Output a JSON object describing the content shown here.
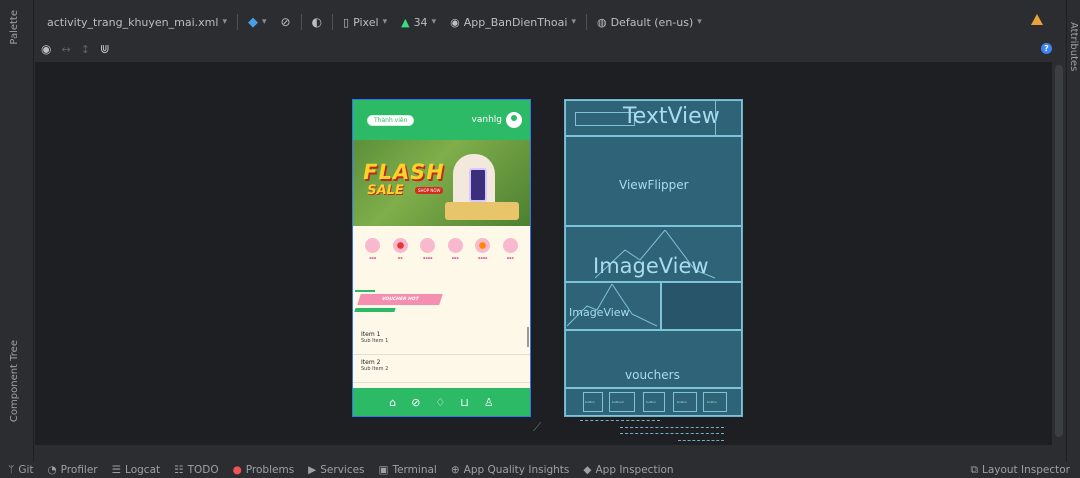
{
  "toolbar": {
    "file_name": "activity_trang_khuyen_mai.xml",
    "device": "Pixel",
    "api": "34",
    "theme": "App_BanDienThoai",
    "locale": "Default (en-us)"
  },
  "side_tabs": {
    "palette": "Palette",
    "component_tree": "Component Tree",
    "attributes": "Attributes"
  },
  "phone": {
    "member_label": "Thành viên",
    "username": "vanhlg",
    "banner_flash": "FLASH",
    "banner_sale": "SALE",
    "shop_now": "SHOP NOW",
    "voucher_label": "VOUCHER HOT",
    "items": [
      {
        "title": "Item 1",
        "sub": "Sub Item 1"
      },
      {
        "title": "Item 2",
        "sub": "Sub Item 2"
      }
    ],
    "nav_icons": [
      "home-icon",
      "tag-icon",
      "bell-icon",
      "cart-icon",
      "person-icon"
    ],
    "categories": [
      "cat1",
      "cat2",
      "cat3",
      "cat4",
      "cat5",
      "cat6"
    ]
  },
  "blueprint": {
    "textview": "TextView",
    "viewflipper": "ViewFlipper",
    "imageview_large": "ImageView",
    "imageview_small": "ImageView",
    "vouchers": "vouchers",
    "buttons": [
      "button",
      "button2",
      "button",
      "button",
      "button"
    ]
  },
  "bottom_bar": {
    "git": "Git",
    "profiler": "Profiler",
    "logcat": "Logcat",
    "todo": "TODO",
    "problems": "Problems",
    "services": "Services",
    "terminal": "Terminal",
    "app_quality": "App Quality Insights",
    "app_inspection": "App Inspection",
    "layout_inspector": "Layout Inspector"
  },
  "colors": {
    "accent": "#3574f0",
    "phone_green": "#2dba67",
    "blueprint": "#2f6377",
    "warning": "#e8a33c"
  }
}
